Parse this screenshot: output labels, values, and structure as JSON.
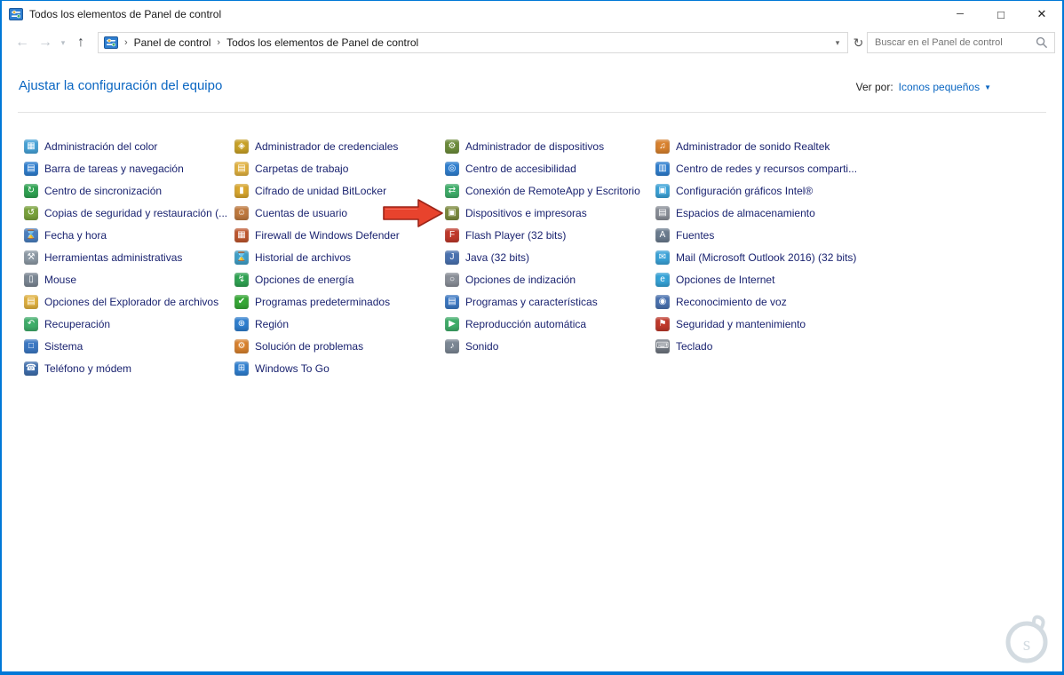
{
  "window": {
    "title": "Todos los elementos de Panel de control",
    "controls": {
      "minimize": "─",
      "maximize": "□",
      "close": "✕"
    }
  },
  "icons": {
    "back": "←",
    "forward": "→",
    "up": "↑",
    "recent_chevron": "▾",
    "address_chevron": "▾",
    "refresh": "↻",
    "view_by_arrow": "▼"
  },
  "navbar": {
    "breadcrumb": {
      "separator": "›",
      "items": [
        "Panel de control",
        "Todos los elementos de Panel de control"
      ]
    },
    "search": {
      "placeholder": "Buscar en el Panel de control"
    }
  },
  "header": {
    "title": "Ajustar la configuración del equipo",
    "view_by_label": "Ver por:",
    "view_by_value": "Iconos pequeños"
  },
  "colors": {
    "accent": "#0078d7",
    "link": "#0a66c2",
    "item_text": "#1a2370",
    "arrow_fill": "#e8432d",
    "arrow_stroke": "#9c2418"
  },
  "columns": [
    {
      "items": [
        {
          "label": "Administración del color",
          "icon": "color-management-icon",
          "icon_color": "#46a3d9",
          "glyph": "▦"
        },
        {
          "label": "Barra de tareas y navegación",
          "icon": "taskbar-navigation-icon",
          "icon_color": "#2f7fd0",
          "glyph": "▤"
        },
        {
          "label": "Centro de sincronización",
          "icon": "sync-center-icon",
          "icon_color": "#2fa352",
          "glyph": "↻"
        },
        {
          "label": "Copias de seguridad y restauración (...",
          "icon": "backup-restore-icon",
          "icon_color": "#7aa33c",
          "glyph": "↺"
        },
        {
          "label": "Fecha y hora",
          "icon": "date-time-icon",
          "icon_color": "#4a7fc0",
          "glyph": "⌛"
        },
        {
          "label": "Herramientas administrativas",
          "icon": "administrative-tools-icon",
          "icon_color": "#8d9aa5",
          "glyph": "⚒"
        },
        {
          "label": "Mouse",
          "icon": "mouse-icon",
          "icon_color": "#7b8794",
          "glyph": "▯"
        },
        {
          "label": "Opciones del Explorador de archivos",
          "icon": "file-explorer-options-icon",
          "icon_color": "#e2b23f",
          "glyph": "▤"
        },
        {
          "label": "Recuperación",
          "icon": "recovery-icon",
          "icon_color": "#3fae6a",
          "glyph": "↶"
        },
        {
          "label": "Sistema",
          "icon": "system-icon",
          "icon_color": "#3b78c4",
          "glyph": "□"
        },
        {
          "label": "Teléfono y módem",
          "icon": "phone-modem-icon",
          "icon_color": "#3f6fae",
          "glyph": "☎"
        }
      ]
    },
    {
      "items": [
        {
          "label": "Administrador de credenciales",
          "icon": "credential-manager-icon",
          "icon_color": "#c9a227",
          "glyph": "◈"
        },
        {
          "label": "Carpetas de trabajo",
          "icon": "work-folders-icon",
          "icon_color": "#e2b23f",
          "glyph": "▤"
        },
        {
          "label": "Cifrado de unidad BitLocker",
          "icon": "bitlocker-icon",
          "icon_color": "#d9a72e",
          "glyph": "▮"
        },
        {
          "label": "Cuentas de usuario",
          "icon": "user-accounts-icon",
          "icon_color": "#c07a3f",
          "glyph": "☺"
        },
        {
          "label": "Firewall de Windows Defender",
          "icon": "defender-firewall-icon",
          "icon_color": "#c0572e",
          "glyph": "▦"
        },
        {
          "label": "Historial de archivos",
          "icon": "file-history-icon",
          "icon_color": "#3fa0c9",
          "glyph": "⌛"
        },
        {
          "label": "Opciones de energía",
          "icon": "power-options-icon",
          "icon_color": "#2fa352",
          "glyph": "↯"
        },
        {
          "label": "Programas predeterminados",
          "icon": "default-programs-icon",
          "icon_color": "#37a837",
          "glyph": "✔"
        },
        {
          "label": "Región",
          "icon": "region-icon",
          "icon_color": "#2f7fd0",
          "glyph": "⊕"
        },
        {
          "label": "Solución de problemas",
          "icon": "troubleshooting-icon",
          "icon_color": "#d9822e",
          "glyph": "⚙"
        },
        {
          "label": "Windows To Go",
          "icon": "windows-to-go-icon",
          "icon_color": "#2f7fd0",
          "glyph": "⊞"
        }
      ]
    },
    {
      "items": [
        {
          "label": "Administrador de dispositivos",
          "icon": "device-manager-icon",
          "icon_color": "#6c8c3a",
          "glyph": "⚙"
        },
        {
          "label": "Centro de accesibilidad",
          "icon": "ease-of-access-icon",
          "icon_color": "#2f7fd0",
          "glyph": "◎"
        },
        {
          "label": "Conexión de RemoteApp y Escritorio",
          "icon": "remoteapp-desktop-icon",
          "icon_color": "#3fae6a",
          "glyph": "⇄"
        },
        {
          "label": "Dispositivos e impresoras",
          "icon": "devices-printers-icon",
          "icon_color": "#7b8a3c",
          "glyph": "▣"
        },
        {
          "label": "Flash Player (32 bits)",
          "icon": "flash-player-icon",
          "icon_color": "#c0392b",
          "glyph": "F"
        },
        {
          "label": "Java (32 bits)",
          "icon": "java-icon",
          "icon_color": "#4a72b0",
          "glyph": "J"
        },
        {
          "label": "Opciones de indización",
          "icon": "indexing-options-icon",
          "icon_color": "#8a8f98",
          "glyph": "○"
        },
        {
          "label": "Programas y características",
          "icon": "programs-features-icon",
          "icon_color": "#3b78c4",
          "glyph": "▤"
        },
        {
          "label": "Reproducción automática",
          "icon": "autoplay-icon",
          "icon_color": "#3fae6a",
          "glyph": "▶"
        },
        {
          "label": "Sonido",
          "icon": "sound-icon",
          "icon_color": "#7b8794",
          "glyph": "♪"
        }
      ]
    },
    {
      "items": [
        {
          "label": "Administrador de sonido Realtek",
          "icon": "realtek-audio-icon",
          "icon_color": "#d9822e",
          "glyph": "♫"
        },
        {
          "label": "Centro de redes y recursos comparti...",
          "icon": "network-sharing-center-icon",
          "icon_color": "#2f7fd0",
          "glyph": "▥"
        },
        {
          "label": "Configuración gráficos Intel®",
          "icon": "intel-graphics-icon",
          "icon_color": "#3aa3d9",
          "glyph": "▣"
        },
        {
          "label": "Espacios de almacenamiento",
          "icon": "storage-spaces-icon",
          "icon_color": "#8a8f98",
          "glyph": "▤"
        },
        {
          "label": "Fuentes",
          "icon": "fonts-icon",
          "icon_color": "#6b7c8f",
          "glyph": "A"
        },
        {
          "label": "Mail (Microsoft Outlook 2016) (32 bits)",
          "icon": "mail-icon",
          "icon_color": "#3aa3d9",
          "glyph": "✉"
        },
        {
          "label": "Opciones de Internet",
          "icon": "internet-options-icon",
          "icon_color": "#35a3d8",
          "glyph": "e"
        },
        {
          "label": "Reconocimiento de voz",
          "icon": "speech-recognition-icon",
          "icon_color": "#4a72b0",
          "glyph": "◉"
        },
        {
          "label": "Seguridad y mantenimiento",
          "icon": "security-maintenance-icon",
          "icon_color": "#c0392b",
          "glyph": "⚑"
        },
        {
          "label": "Teclado",
          "icon": "keyboard-icon",
          "icon_color": "#6f7680",
          "glyph": "⌨"
        }
      ]
    }
  ]
}
